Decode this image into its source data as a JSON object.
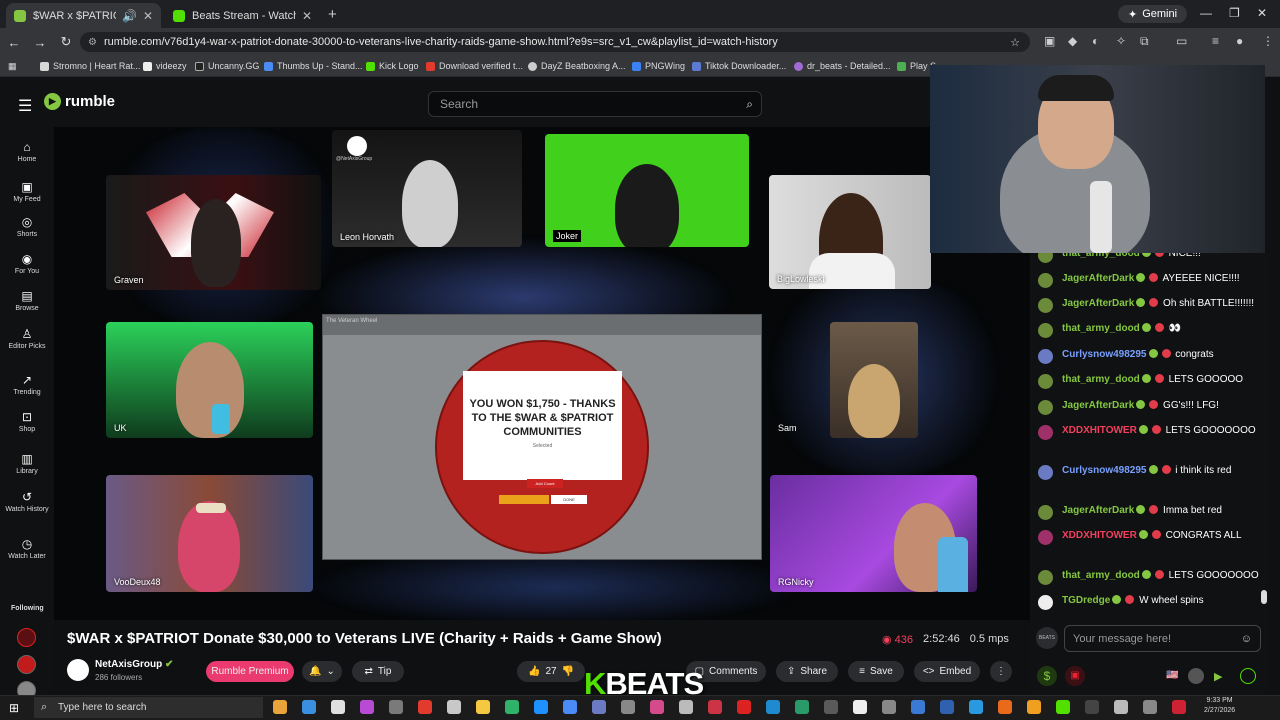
{
  "browser": {
    "tabs": [
      {
        "title": "$WAR x $PATRIOT Donate $",
        "favicon_color": "#85c742"
      },
      {
        "title": "Beats Stream - Watch Live on K",
        "favicon_color": "#52e000"
      }
    ],
    "gemini_label": "Gemini",
    "url": "rumble.com/v76d1y4-war-x-patriot-donate-30000-to-veterans-live-charity-raids-game-show.html?e9s=src_v1_cw&playlist_id=watch-history",
    "bookmarks": [
      "Stromno | Heart Rat...",
      "videezy",
      "Uncanny.GG",
      "Thumbs Up - Stand...",
      "Kick Logo",
      "Download verified t...",
      "DayZ Beatboxing A...",
      "PNGWing",
      "Tiktok Downloader...",
      "dr_beats - Detailed...",
      "Play S"
    ]
  },
  "site": {
    "logo": "rumble",
    "search_placeholder": "Search",
    "sidebar": [
      {
        "label": "Home",
        "icon": "home-icon",
        "glyph": "⌂"
      },
      {
        "label": "My Feed",
        "icon": "feed-icon",
        "glyph": "▣"
      },
      {
        "label": "Shorts",
        "icon": "shorts-icon",
        "glyph": "◎"
      },
      {
        "label": "For You",
        "icon": "for-you-icon",
        "glyph": "◉"
      },
      {
        "label": "Browse",
        "icon": "browse-icon",
        "glyph": "▤"
      },
      {
        "label": "Editor Picks",
        "icon": "editor-picks-icon",
        "glyph": "♙"
      },
      {
        "label": "Trending",
        "icon": "trending-icon",
        "glyph": "↗"
      },
      {
        "label": "Shop",
        "icon": "shop-icon",
        "glyph": "⊡"
      },
      {
        "label": "Library",
        "icon": "library-icon",
        "glyph": "▥"
      },
      {
        "label": "Watch History",
        "icon": "history-icon",
        "glyph": "↺"
      },
      {
        "label": "Watch Later",
        "icon": "clock-icon",
        "glyph": "◷"
      }
    ],
    "following_label": "Following"
  },
  "stream": {
    "cams": [
      "Graven",
      "Leon Horvath",
      "Joker",
      "BigLowleski",
      "UK",
      "Sam",
      "VooDeux48",
      "RGNicky"
    ],
    "cam_logo": "@NetAxisGroup",
    "wheel_title": "The Veteran Wheel",
    "prize_text": "YOU WON $1,750 - THANKS TO THE $WAR & $PATRIOT COMMUNITIES",
    "prize_sub": "Selected",
    "prize_btn_1": "Add Count",
    "prize_btn_2": "DONE"
  },
  "video": {
    "title": "$WAR x $PATRIOT Donate $30,000 to Veterans LIVE (Charity + Raids + Game Show)",
    "viewers": "436",
    "duration": "2:52:46",
    "bitrate": "0.5 mps",
    "channel": "NetAxisGroup",
    "followers": "286 followers",
    "premium_label": "Rumble Premium",
    "tip_label": "Tip",
    "likes": "27",
    "comments_label": "Comments",
    "share_label": "Share",
    "save_label": "Save",
    "embed_label": "Embed"
  },
  "chat": {
    "messages": [
      {
        "user": "that_army_dood",
        "text": "NICE!!!",
        "color": "#85c742"
      },
      {
        "user": "JagerAfterDark",
        "text": "AYEEEE NICE!!!!",
        "color": "#85c742"
      },
      {
        "user": "JagerAfterDark",
        "text": "Oh shit BATTLE!!!!!!!",
        "color": "#85c742"
      },
      {
        "user": "that_army_dood",
        "text": "👀",
        "color": "#85c742"
      },
      {
        "user": "Curlysnow498295",
        "text": "congrats",
        "color": "#7aa0ff"
      },
      {
        "user": "that_army_dood",
        "text": "LETS GOOOOO",
        "color": "#85c742"
      },
      {
        "user": "JagerAfterDark",
        "text": "GG's!!! LFG!",
        "color": "#85c742"
      },
      {
        "user": "XDDXHITOWER",
        "text": "LETS GOOOOOOO",
        "color": "#f43f5e"
      },
      {
        "user": "Curlysnow498295",
        "text": "i think its red",
        "color": "#7aa0ff"
      },
      {
        "user": "JagerAfterDark",
        "text": "Imma bet red",
        "color": "#85c742"
      },
      {
        "user": "XDDXHITOWER",
        "text": "CONGRATS ALL",
        "color": "#f43f5e"
      },
      {
        "user": "that_army_dood",
        "text": "LETS GOOOOOOO",
        "color": "#85c742"
      },
      {
        "user": "TGDredge",
        "text": "W wheel spins",
        "color": "#85c742"
      }
    ],
    "input_placeholder": "Your message here!"
  },
  "overlay": {
    "brand": "BEATS",
    "brand_k": "K"
  },
  "taskbar": {
    "search_placeholder": "Type here to search",
    "time": "9:33 PM",
    "date": "2/27/2026"
  }
}
